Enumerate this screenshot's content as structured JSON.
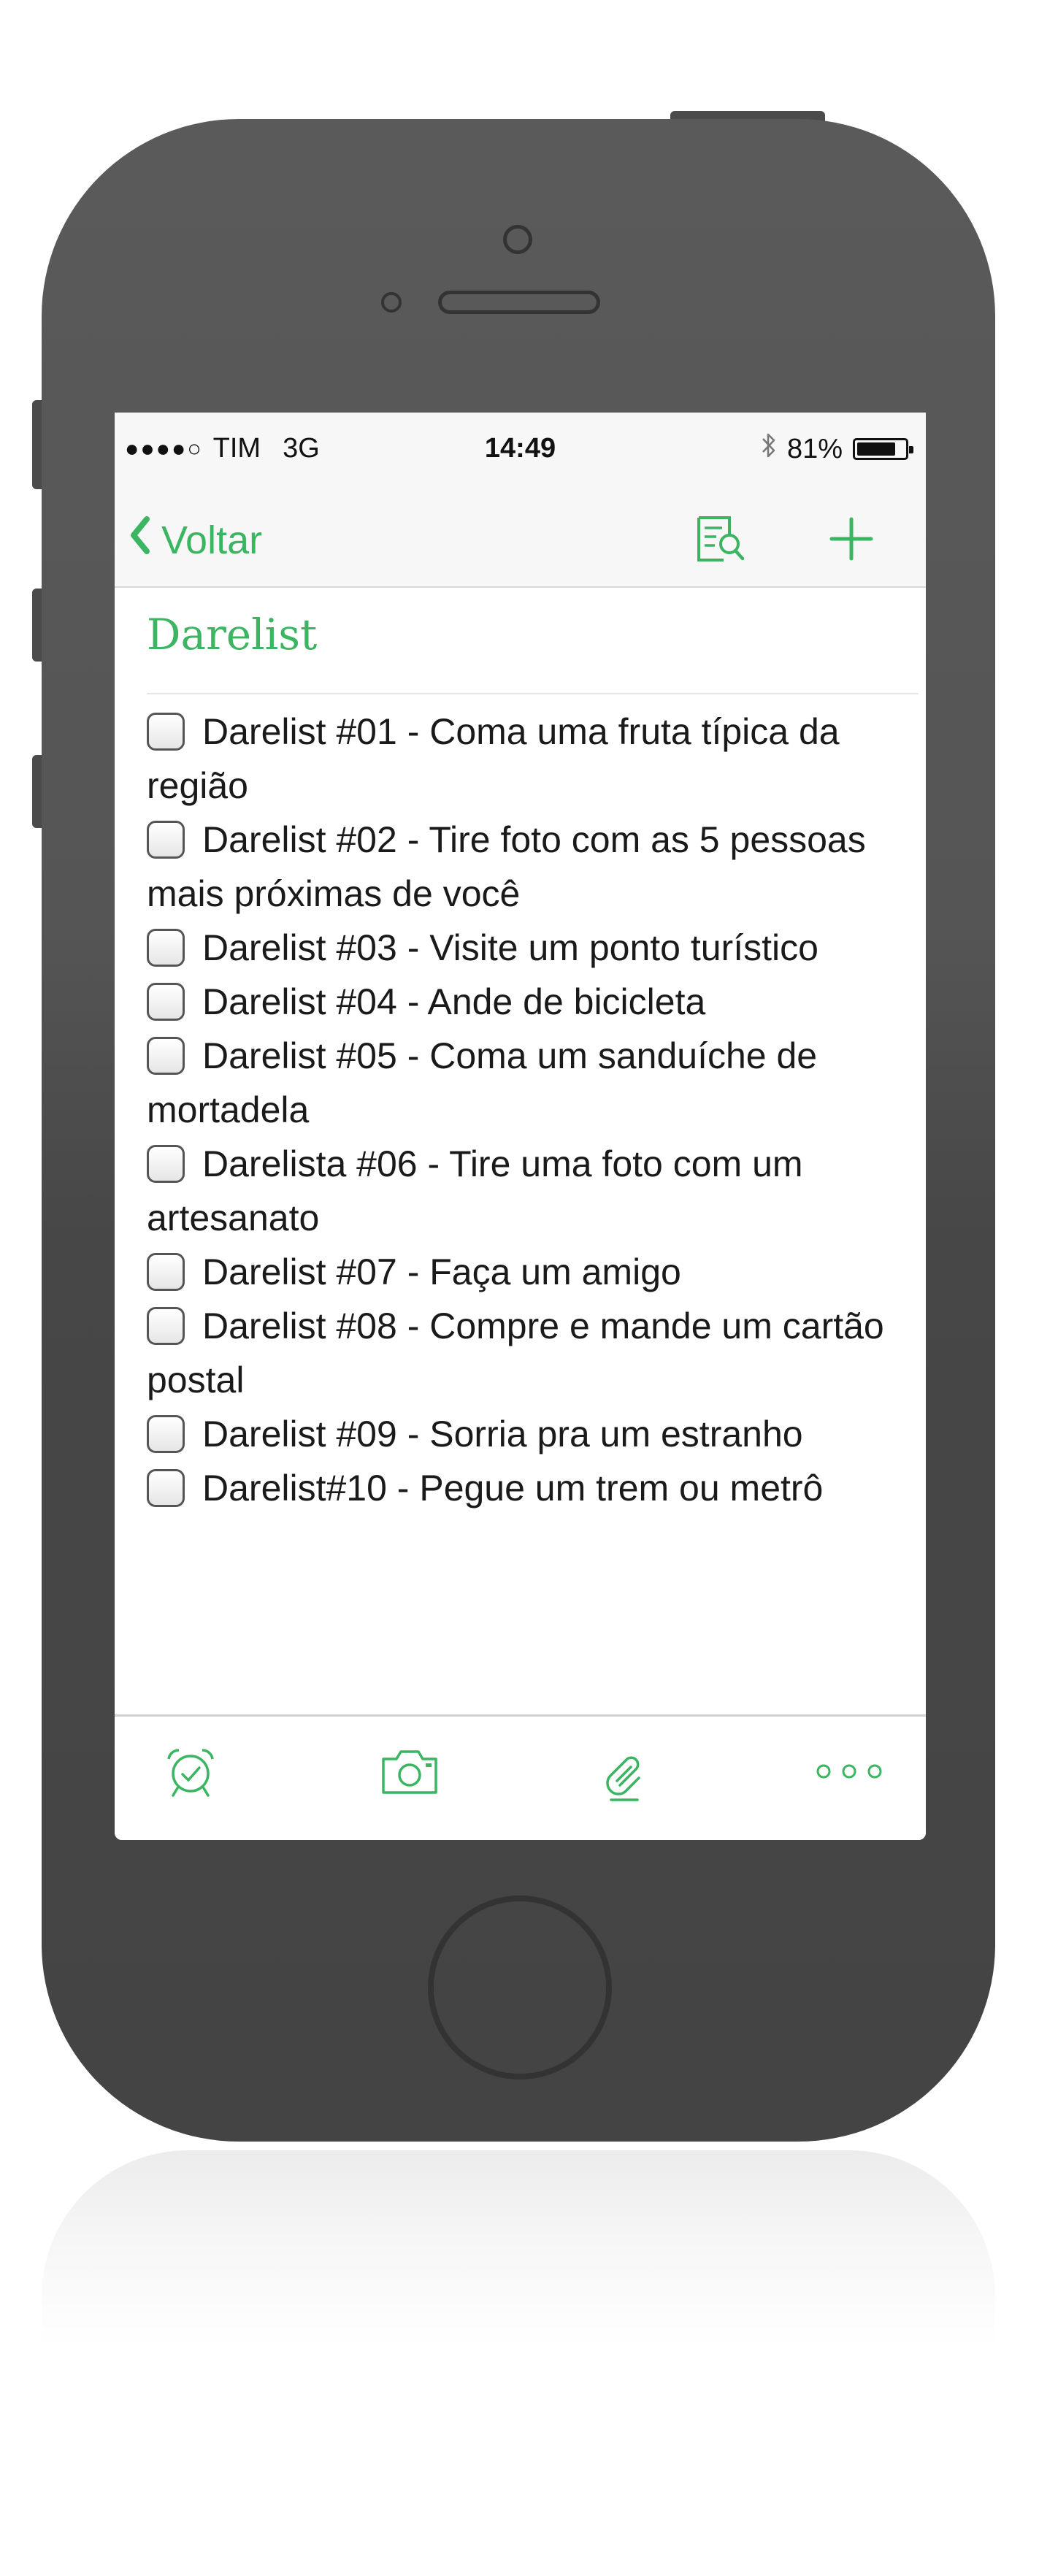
{
  "colors": {
    "accent": "#3bb561",
    "phone_body": "#555555",
    "text": "#1a1a1a"
  },
  "status_bar": {
    "signal": "●●●●○",
    "carrier": "TIM",
    "network": "3G",
    "time": "14:49",
    "bluetooth_icon": "bluetooth-icon",
    "battery_percent": "81%",
    "battery_level": 0.81
  },
  "nav": {
    "back_label": "Voltar",
    "back_icon": "chevron-left-icon",
    "search_icon": "note-search-icon",
    "add_icon": "plus-icon"
  },
  "note": {
    "title": "Darelist",
    "items": [
      "Darelist #01 - Coma uma fruta típica da região",
      "Darelist #02 - Tire foto com as 5 pessoas mais próximas de você",
      "Darelist #03 - Visite um ponto turístico",
      "Darelist #04 - Ande de bicicleta",
      "Darelist #05 - Coma um sanduíche de mortadela",
      "Darelista #06 - Tire uma foto com um artesanato",
      "Darelist #07 - Faça um amigo",
      "Darelist #08 - Compre e mande um cartão postal",
      "Darelist #09 - Sorria pra um estranho",
      "Darelist#10 - Pegue um trem ou metrô"
    ]
  },
  "toolbar": {
    "icons": [
      "alarm-clock-icon",
      "camera-icon",
      "attachment-icon",
      "more-icon"
    ]
  }
}
